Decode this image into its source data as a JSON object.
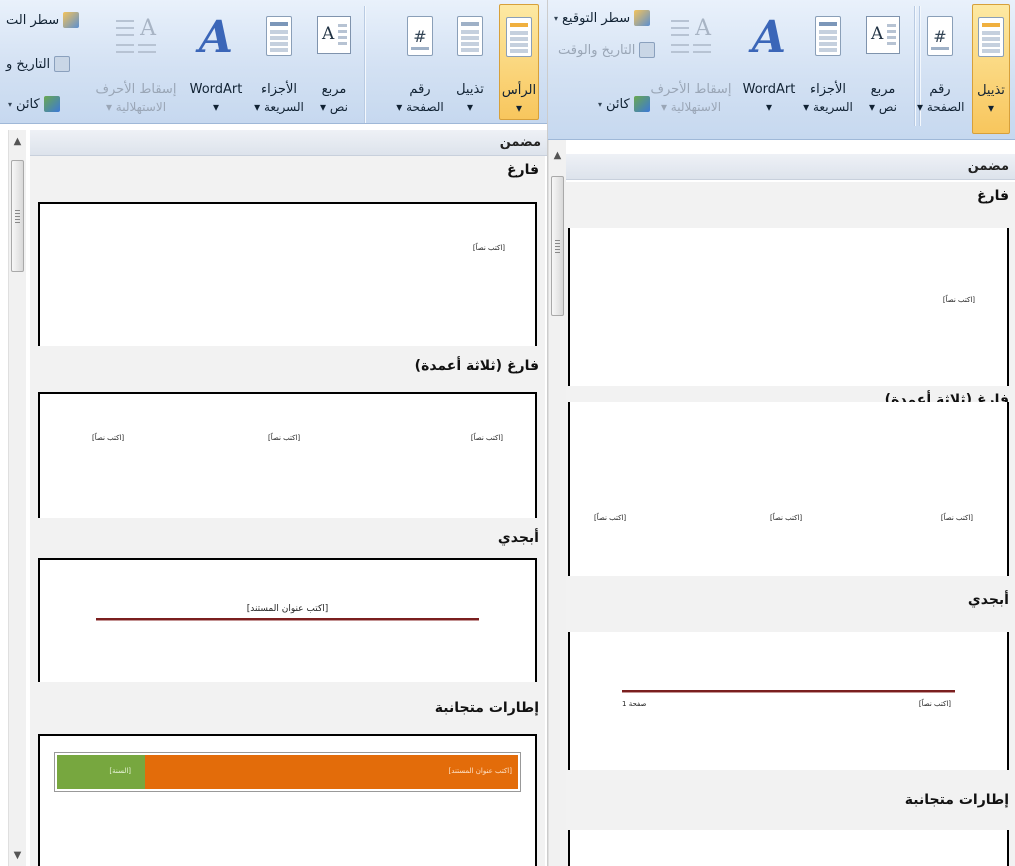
{
  "ribbon": {
    "header": {
      "line1": "تذييل",
      "line2_left": "الرأس"
    },
    "footer": "تذييل",
    "page_number": {
      "line1": "رقم",
      "line2": "الصفحة"
    },
    "text_box": {
      "line1": "مربع",
      "line2": "نص"
    },
    "quick_parts": {
      "line1": "الأجزاء",
      "line2": "السريعة"
    },
    "wordart": "WordArt",
    "drop_cap": {
      "line1": "إسقاط الأحرف",
      "line2": "الاستهلالية"
    },
    "signature_line": "سطر التوقيع",
    "date_time": "التاريخ والوقت",
    "object": "كائن",
    "signature_line_cut": "سطر الت",
    "date_time_cut": "التاريخ و"
  },
  "gallery": {
    "category": "مضمن",
    "items": [
      "فارغ",
      "فارغ (ثلاثة أعمدة)",
      "أبجدي",
      "إطارات متجانبة"
    ],
    "placeholder_text": "[اكتب نصاً]",
    "doc_title_placeholder": "[اكتب عنوان المستند]",
    "year_placeholder": "[السنة]",
    "page_label": "صفحة 1"
  },
  "colors": {
    "accent_orange": "#e36c0a",
    "accent_green": "#77a73f",
    "rule": "#7a1f1f",
    "ribbon_selected": "#f8c65d"
  }
}
